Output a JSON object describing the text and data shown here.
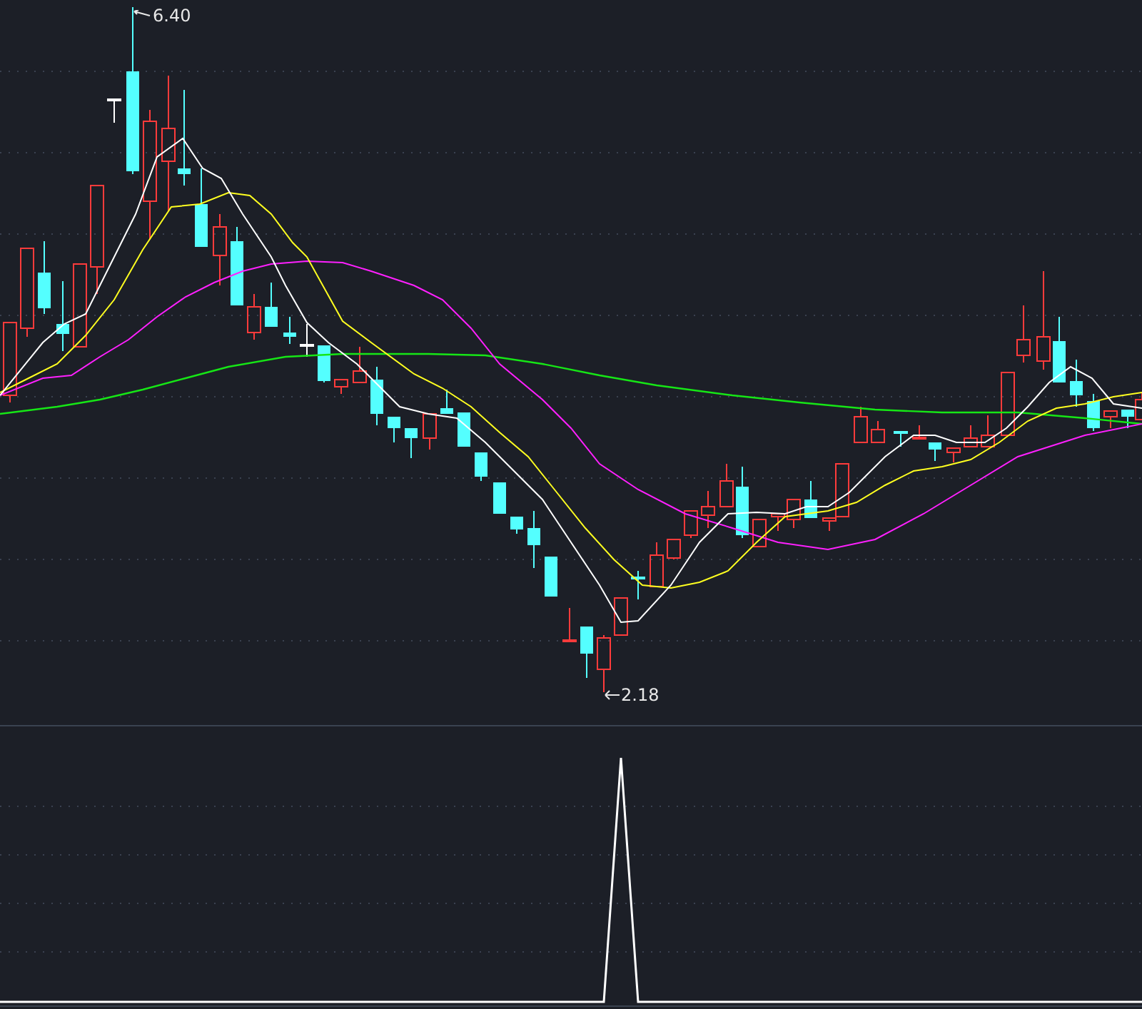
{
  "price_chart": {
    "high_label": "6.40",
    "low_label": "2.18"
  }
}
